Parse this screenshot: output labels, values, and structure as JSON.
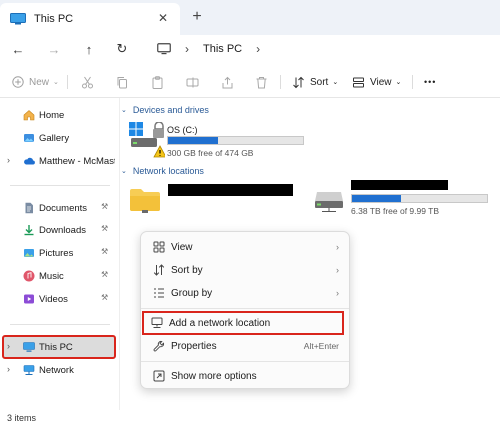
{
  "window": {
    "tab_title": "This PC",
    "close_glyph": "✕",
    "new_tab_glyph": "+"
  },
  "nav": {
    "back_glyph": "←",
    "forward_glyph": "→",
    "up_glyph": "↑",
    "refresh_glyph": "↻",
    "breadcrumb_sep": "›",
    "location": "This PC"
  },
  "toolbar": {
    "new_label": "New",
    "sort_label": "Sort",
    "view_label": "View",
    "more_glyph": "•••",
    "chevron_glyph": "⌄"
  },
  "sidebar": {
    "items": [
      {
        "label": "Home",
        "icon": "home-icon"
      },
      {
        "label": "Gallery",
        "icon": "gallery-icon"
      },
      {
        "label": "Matthew - McMaster",
        "icon": "cloud-icon"
      },
      {
        "label": "Documents",
        "icon": "documents-icon"
      },
      {
        "label": "Downloads",
        "icon": "downloads-icon"
      },
      {
        "label": "Pictures",
        "icon": "pictures-icon"
      },
      {
        "label": "Music",
        "icon": "music-icon"
      },
      {
        "label": "Videos",
        "icon": "videos-icon"
      },
      {
        "label": "This PC",
        "icon": "pc-icon",
        "selected": true
      },
      {
        "label": "Network",
        "icon": "network-icon"
      }
    ],
    "pin_glyph": "📌",
    "expand_glyph": "›"
  },
  "content": {
    "groups": [
      {
        "title": "Devices and drives"
      },
      {
        "title": "Network locations"
      }
    ],
    "drives": [
      {
        "name": "OS (C:)",
        "free_text": "300 GB free of 474 GB",
        "used_fraction": 0.367
      },
      {
        "name": "",
        "free_text": "6.38 TB free of 9.99 TB",
        "used_fraction": 0.361
      }
    ]
  },
  "context_menu": {
    "items": [
      {
        "label": "View",
        "icon": "view-icon",
        "chevron": "›"
      },
      {
        "label": "Sort by",
        "icon": "sort-icon",
        "chevron": "›"
      },
      {
        "label": "Group by",
        "icon": "group-icon",
        "chevron": "›"
      },
      {
        "label": "Add a network location",
        "icon": "network-location-icon",
        "highlighted": true
      },
      {
        "label": "Properties",
        "icon": "properties-icon",
        "shortcut": "Alt+Enter"
      },
      {
        "label": "Show more options",
        "icon": "more-options-icon"
      }
    ]
  },
  "status": {
    "items_text": "3 items"
  },
  "colors": {
    "accent": "#2070d0",
    "annotation_red": "#d9251c",
    "group_header": "#2a5a96"
  }
}
